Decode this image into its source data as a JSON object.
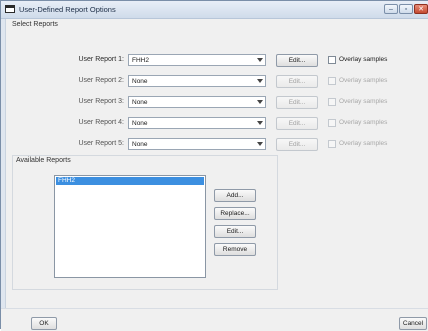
{
  "window": {
    "title": "User-Defined Report Options"
  },
  "select_reports": {
    "group_title": "Select Reports",
    "rows": [
      {
        "label": "User Report 1:",
        "value": "FHH2",
        "edit_label": "Edit...",
        "overlay_label": "Overlay samples",
        "enabled": true
      },
      {
        "label": "User Report 2:",
        "value": "None",
        "edit_label": "Edit...",
        "overlay_label": "Overlay samples",
        "enabled": false
      },
      {
        "label": "User Report 3:",
        "value": "None",
        "edit_label": "Edit...",
        "overlay_label": "Overlay samples",
        "enabled": false
      },
      {
        "label": "User Report 4:",
        "value": "None",
        "edit_label": "Edit...",
        "overlay_label": "Overlay samples",
        "enabled": false
      },
      {
        "label": "User Report 5:",
        "value": "None",
        "edit_label": "Edit...",
        "overlay_label": "Overlay samples",
        "enabled": false
      }
    ]
  },
  "available_reports": {
    "group_title": "Available Reports",
    "items": [
      "FHH2"
    ],
    "buttons": {
      "add": "Add...",
      "replace": "Replace...",
      "edit": "Edit...",
      "remove": "Remove"
    }
  },
  "footer": {
    "ok_label": "OK",
    "cancel_label": "Cancel"
  },
  "colors": {
    "selection": "#3c8fe0",
    "close_button": "#c44a30"
  }
}
